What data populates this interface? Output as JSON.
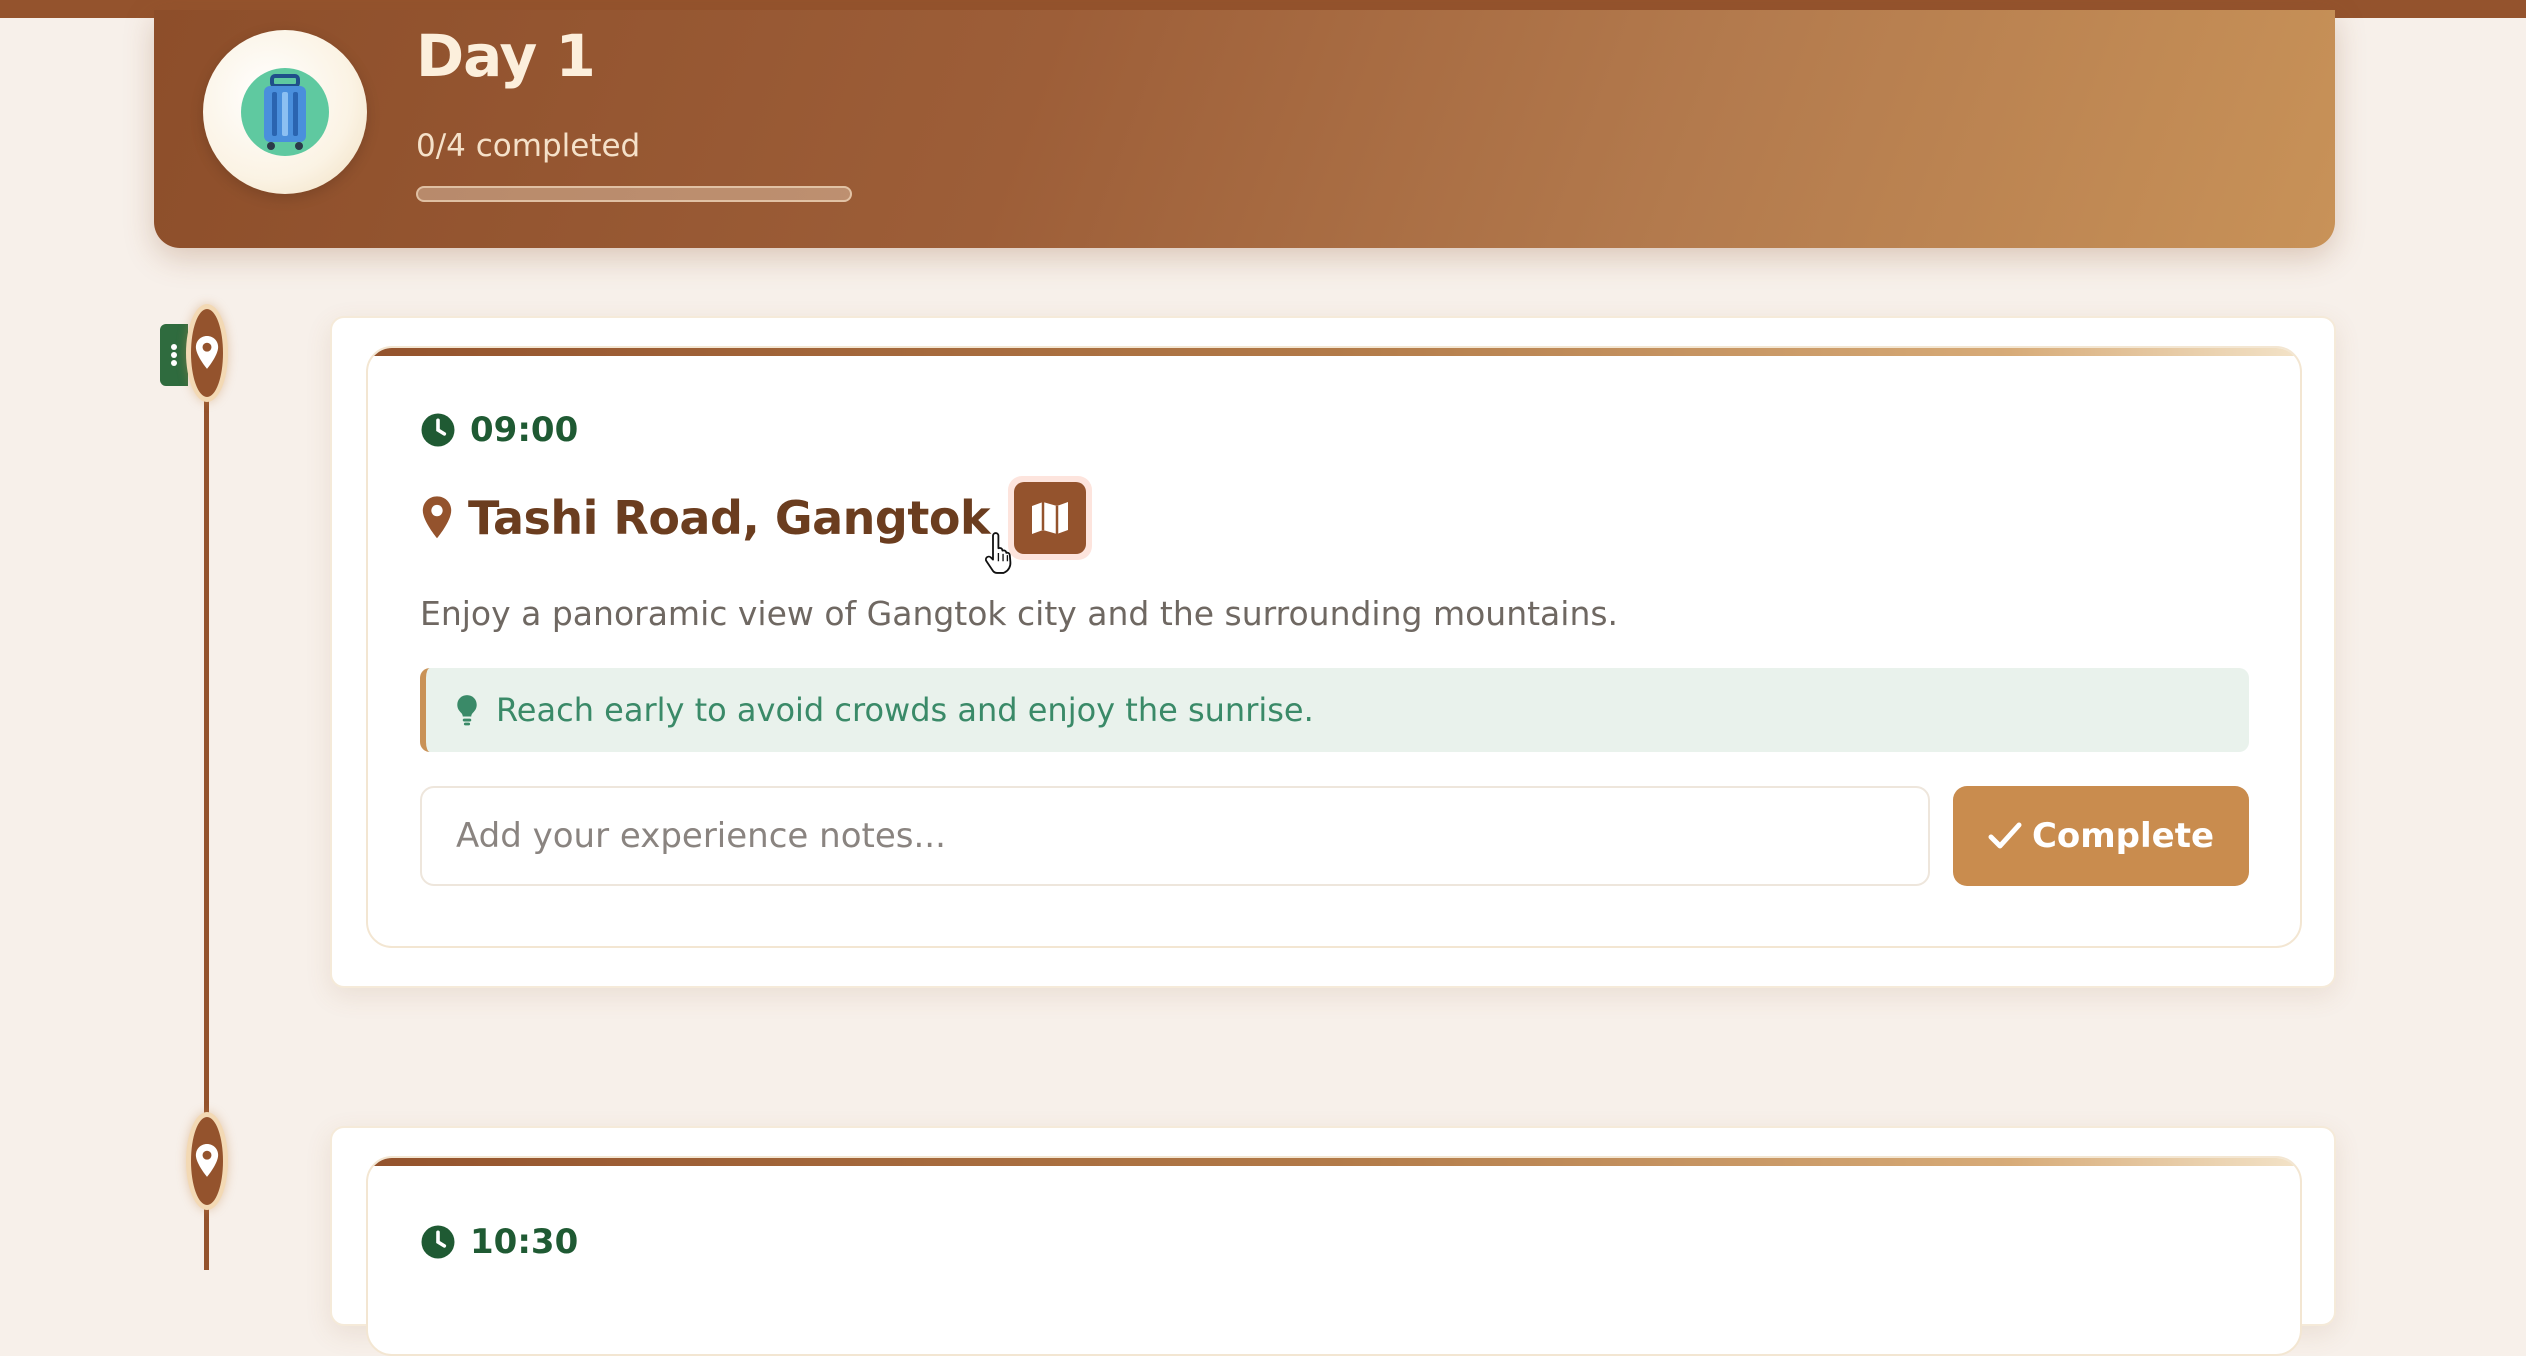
{
  "day": {
    "title": "Day 1",
    "progress_text": "0/4 completed",
    "progress_fraction": 0,
    "avatar_icon": "luggage-icon"
  },
  "activities": [
    {
      "time": "09:00",
      "place": "Tashi Road, Gangtok",
      "description": "Enjoy a panoramic view of Gangtok city and the surrounding mountains.",
      "tip": "Reach early to avoid crowds and enjoy the sunrise.",
      "notes_placeholder": "Add your experience notes...",
      "complete_label": "Complete"
    },
    {
      "time": "10:30"
    }
  ],
  "colors": {
    "brand_brown": "#94532d",
    "accent_tan": "#c98c4e",
    "time_green": "#1f5a33",
    "tip_bg": "#e9f2ec",
    "tip_text": "#3a8a68",
    "page_bg": "#f7f0ea"
  },
  "icons": [
    "luggage-icon",
    "clock-icon",
    "map-pin-icon",
    "map-icon",
    "lightbulb-icon",
    "check-icon",
    "pointer-cursor-icon",
    "grip-icon"
  ]
}
